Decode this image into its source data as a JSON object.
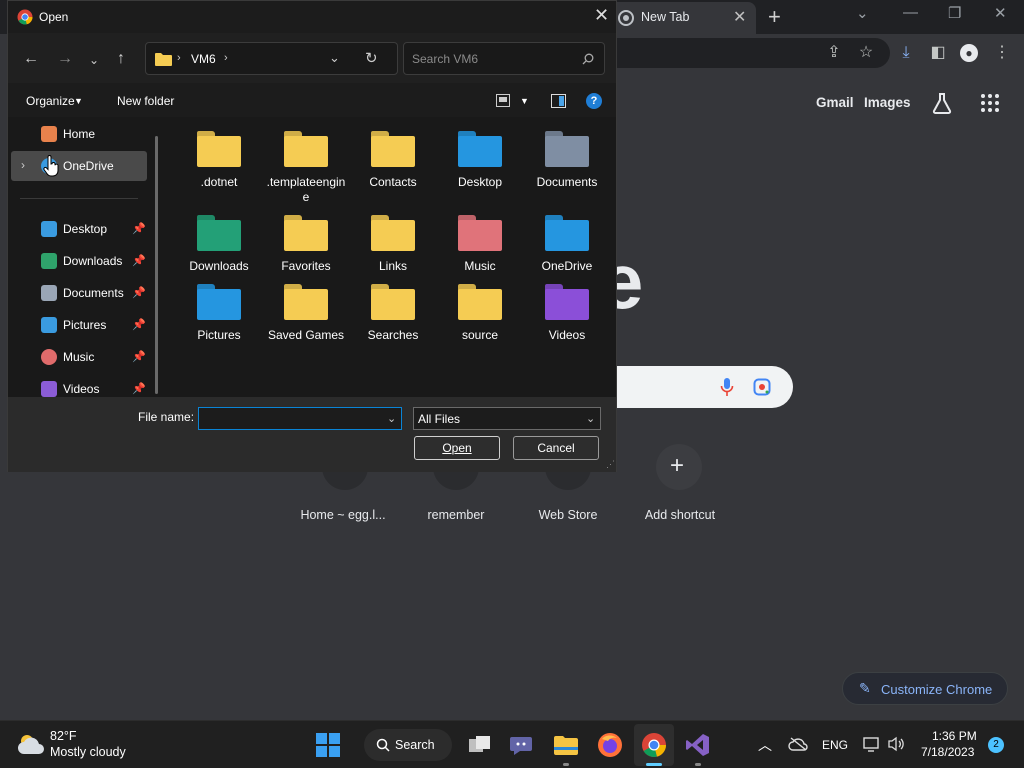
{
  "browser": {
    "tab_title": "New Tab",
    "header_links": {
      "gmail": "Gmail",
      "images": "Images"
    },
    "logo_fragment": "e",
    "shortcuts": [
      {
        "label": "Home ~ egg.l..."
      },
      {
        "label": "remember"
      },
      {
        "label": "Web Store"
      },
      {
        "label": "Add shortcut"
      }
    ],
    "customize_label": "Customize Chrome"
  },
  "dialog": {
    "title": "Open",
    "address": {
      "crumb": "VM6"
    },
    "search_placeholder": "Search VM6",
    "commands": {
      "organize": "Organize",
      "new_folder": "New folder"
    },
    "nav_items": [
      {
        "label": "Home",
        "pinned": false,
        "color": "#e8824c"
      },
      {
        "label": "OneDrive",
        "pinned": false,
        "color": "#3a9be0"
      },
      {
        "label": "Desktop",
        "pinned": true,
        "color": "#3a9be0"
      },
      {
        "label": "Downloads",
        "pinned": true,
        "color": "#2fa36b"
      },
      {
        "label": "Documents",
        "pinned": true,
        "color": "#9aa6b6"
      },
      {
        "label": "Pictures",
        "pinned": true,
        "color": "#3a9be0"
      },
      {
        "label": "Music",
        "pinned": true,
        "color": "#e06b6b"
      },
      {
        "label": "Videos",
        "pinned": true,
        "color": "#8b5cd6"
      }
    ],
    "items": [
      {
        "label": ".dotnet",
        "kind": "folder",
        "color": "#f5cc53"
      },
      {
        "label": ".templateengine",
        "kind": "folder",
        "color": "#f5cc53"
      },
      {
        "label": "Contacts",
        "kind": "folder",
        "color": "#f5cc53"
      },
      {
        "label": "Desktop",
        "kind": "folder",
        "color": "#2596e0"
      },
      {
        "label": "Documents",
        "kind": "folder",
        "color": "#7f8ea3"
      },
      {
        "label": "Downloads",
        "kind": "folder",
        "color": "#23a077"
      },
      {
        "label": "Favorites",
        "kind": "folder",
        "color": "#f5cc53"
      },
      {
        "label": "Links",
        "kind": "folder",
        "color": "#f5cc53"
      },
      {
        "label": "Music",
        "kind": "folder",
        "color": "#e0737a"
      },
      {
        "label": "OneDrive",
        "kind": "folder",
        "color": "#2596e0"
      },
      {
        "label": "Pictures",
        "kind": "folder",
        "color": "#2596e0"
      },
      {
        "label": "Saved Games",
        "kind": "folder",
        "color": "#f5cc53"
      },
      {
        "label": "Searches",
        "kind": "folder",
        "color": "#f5cc53"
      },
      {
        "label": "source",
        "kind": "folder",
        "color": "#f5cc53"
      },
      {
        "label": "Videos",
        "kind": "folder",
        "color": "#8b4fd8"
      }
    ],
    "file_name_label": "File name:",
    "file_name_value": "",
    "file_type": "All Files",
    "open_label": "Open",
    "cancel_label": "Cancel"
  },
  "taskbar": {
    "weather_temp": "82°F",
    "weather_desc": "Mostly cloudy",
    "search_label": "Search",
    "language": "ENG",
    "time": "1:36 PM",
    "date": "7/18/2023",
    "notification_count": "2"
  }
}
